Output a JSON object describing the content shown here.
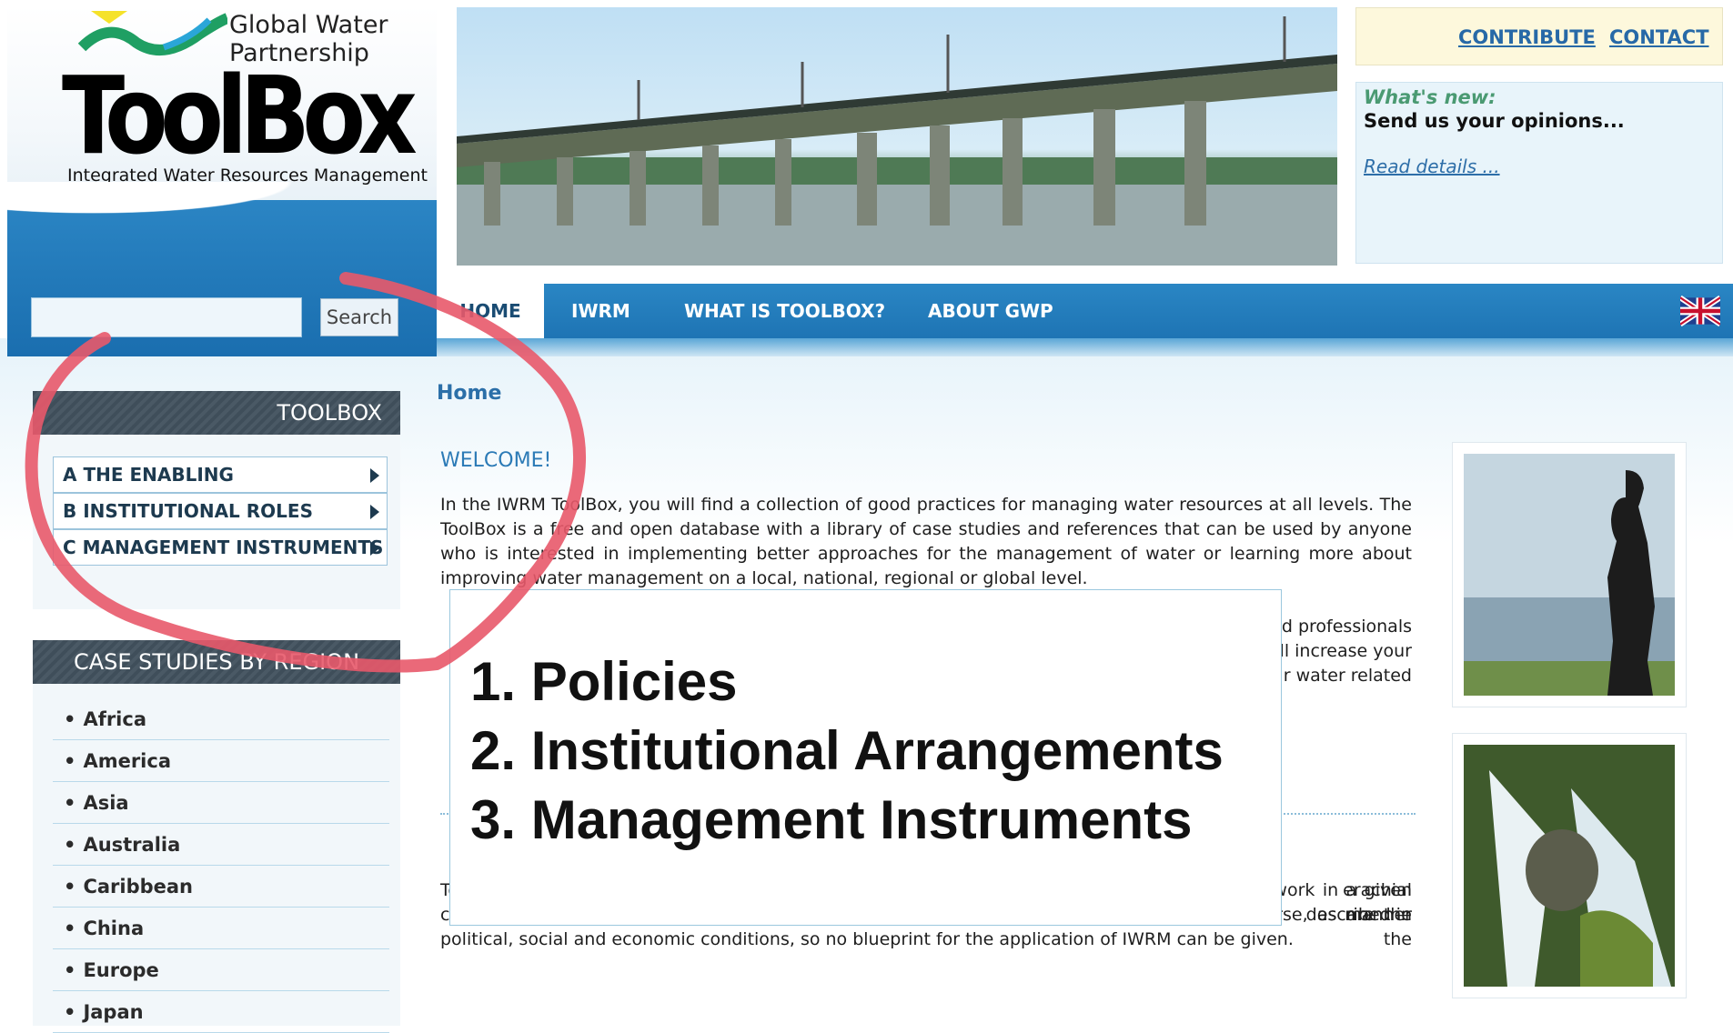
{
  "logo": {
    "gwp_line1": "Global Water",
    "gwp_line2": "Partnership",
    "brand": "ToolBox",
    "tagline": "Integrated Water Resources Management"
  },
  "search": {
    "value": "",
    "placeholder": "",
    "button_label": "Search"
  },
  "top_links": {
    "contribute": "CONTRIBUTE",
    "contact": "CONTACT"
  },
  "whats_new": {
    "label": "What's new:",
    "text": "Send us your opinions...",
    "link": "Read details ..."
  },
  "nav": {
    "tabs": [
      "HOME",
      "IWRM",
      "WHAT IS TOOLBOX?",
      "ABOUT GWP"
    ]
  },
  "sidebar": {
    "toolbox_title": "TOOLBOX",
    "toolbox_items": [
      "A THE ENABLING ENVIRONMENT",
      "B INSTITUTIONAL ROLES",
      "C MANAGEMENT INSTRUMENTS"
    ],
    "case_studies_title": "CASE STUDIES BY REGION",
    "regions": [
      "Africa",
      "America",
      "Asia",
      "Australia",
      "Caribbean",
      "China",
      "Europe",
      "Japan"
    ]
  },
  "content": {
    "breadcrumb": "Home",
    "welcome_title": "WELCOME!",
    "para1": "In the IWRM ToolBox, you will find a collection of good practices for managing water resources at all levels. The ToolBox is a free and open database with a library of case studies and references that can be used by anyone who is interested in implementing better approaches for the management of water or learning more about improving water management on a local, national, regional or global level.",
    "para2_fragment_1": "d professionals",
    "para2_fragment_2": "ll increase your",
    "para2_fragment_3": "r water related",
    "para3_fragment_1": "erachial manner",
    "para3_fragment_2": "described in the",
    "para4": "ToolBox such as to allow the user to select a suitable mix and sequence of tools that would work in a given country, context and situation. The problems faced by water managers are many and diverse, as are the political, social and economic conditions, so no blueprint for the application of IWRM can be given."
  },
  "overlay": {
    "lines": [
      "1. Policies",
      "2. Institutional Arrangements",
      "3. Management Instruments"
    ]
  },
  "colors": {
    "nav_blue": "#2a86c4",
    "header_dark": "#3f4e5a",
    "link_blue": "#2769a7",
    "annotation_red": "#e8596a"
  }
}
